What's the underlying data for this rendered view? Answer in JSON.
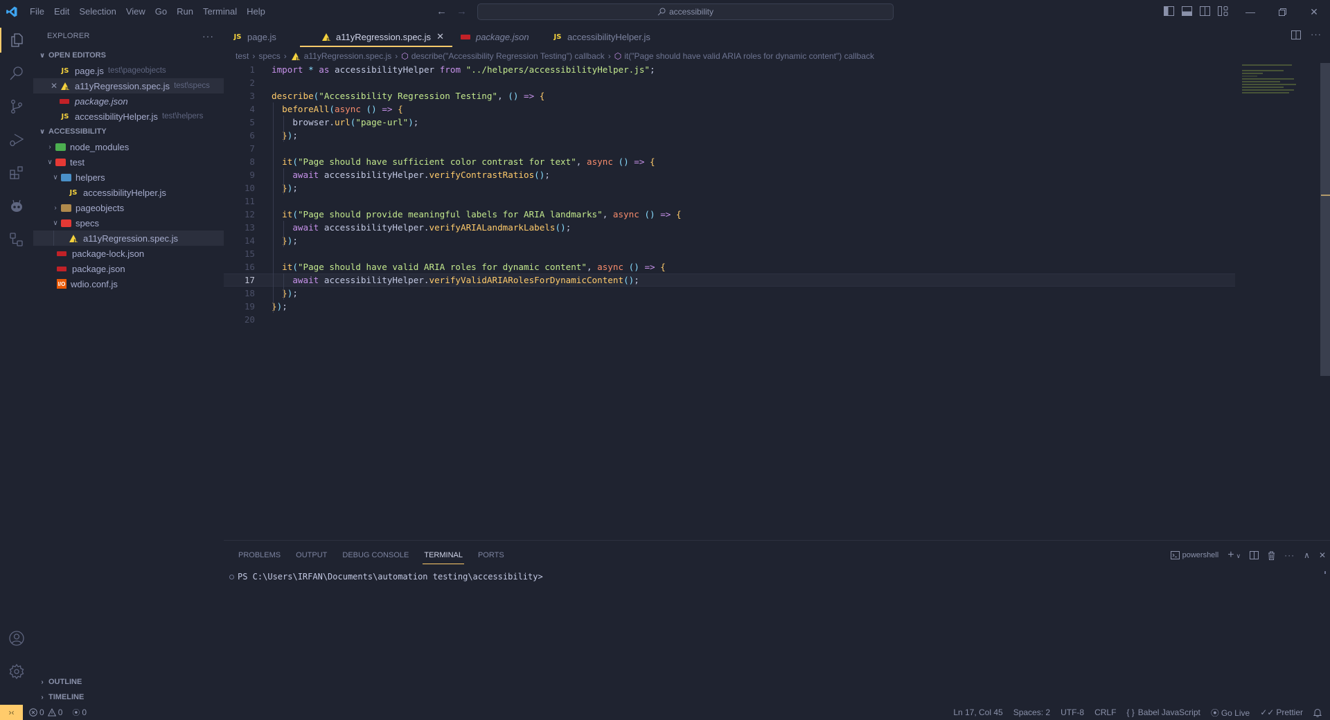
{
  "titlebar": {
    "menu": [
      "File",
      "Edit",
      "Selection",
      "View",
      "Go",
      "Run",
      "Terminal",
      "Help"
    ],
    "command_center": "accessibility",
    "window_controls": [
      "minimize",
      "restore",
      "close"
    ]
  },
  "activity_bar": {
    "items": [
      "explorer",
      "search",
      "source-control",
      "run-and-debug",
      "extensions",
      "platformio",
      "remote-explorer"
    ],
    "bottom": [
      "accounts",
      "manage"
    ]
  },
  "sidebar": {
    "title": "EXPLORER",
    "open_editors_label": "OPEN EDITORS",
    "open_editors": [
      {
        "icon": "js",
        "name": "page.js",
        "desc": "test\\pageobjects",
        "italic": false
      },
      {
        "icon": "spec",
        "name": "a11yRegression.spec.js",
        "desc": "test\\specs",
        "italic": false,
        "selected": true
      },
      {
        "icon": "npm",
        "name": "package.json",
        "desc": "",
        "italic": true
      },
      {
        "icon": "js",
        "name": "accessibilityHelper.js",
        "desc": "test\\helpers",
        "italic": false
      }
    ],
    "project_label": "ACCESSIBILITY",
    "tree": [
      {
        "name": "node_modules",
        "type": "folder",
        "icon": "folder-node",
        "expanded": false,
        "depth": 0
      },
      {
        "name": "test",
        "type": "folder",
        "icon": "folder-test",
        "expanded": true,
        "depth": 0
      },
      {
        "name": "helpers",
        "type": "folder",
        "icon": "folder-helper",
        "expanded": true,
        "depth": 1
      },
      {
        "name": "accessibilityHelper.js",
        "type": "file",
        "icon": "js",
        "depth": 2
      },
      {
        "name": "pageobjects",
        "type": "folder",
        "icon": "folder",
        "expanded": false,
        "depth": 1
      },
      {
        "name": "specs",
        "type": "folder",
        "icon": "folder-test",
        "expanded": true,
        "depth": 1
      },
      {
        "name": "a11yRegression.spec.js",
        "type": "file",
        "icon": "spec",
        "depth": 2,
        "selected": true
      },
      {
        "name": "package-lock.json",
        "type": "file",
        "icon": "npm",
        "depth": 0
      },
      {
        "name": "package.json",
        "type": "file",
        "icon": "npm",
        "depth": 0
      },
      {
        "name": "wdio.conf.js",
        "type": "file",
        "icon": "wdio",
        "depth": 0
      }
    ],
    "outline_label": "OUTLINE",
    "timeline_label": "TIMELINE"
  },
  "tabs": [
    {
      "icon": "js",
      "label": "page.js",
      "active": false,
      "italic": false
    },
    {
      "icon": "spec",
      "label": "a11yRegression.spec.js",
      "active": true,
      "italic": false
    },
    {
      "icon": "npm",
      "label": "package.json",
      "active": false,
      "italic": true
    },
    {
      "icon": "js",
      "label": "accessibilityHelper.js",
      "active": false,
      "italic": false
    }
  ],
  "breadcrumb": [
    "test",
    "specs",
    "a11yRegression.spec.js",
    "describe(\"Accessibility Regression Testing\") callback",
    "it(\"Page should have valid ARIA roles for dynamic content\") callback"
  ],
  "editor": {
    "current_line": 17,
    "lines": [
      "import * as accessibilityHelper from \"../helpers/accessibilityHelper.js\";",
      "",
      "describe(\"Accessibility Regression Testing\", () => {",
      "  beforeAll(async () => {",
      "    browser.url(\"page-url\");",
      "  });",
      "",
      "  it(\"Page should have sufficient color contrast for text\", async () => {",
      "    await accessibilityHelper.verifyContrastRatios();",
      "  });",
      "",
      "  it(\"Page should provide meaningful labels for ARIA landmarks\", async () => {",
      "    await accessibilityHelper.verifyARIALandmarkLabels();",
      "  });",
      "",
      "  it(\"Page should have valid ARIA roles for dynamic content\", async () => {",
      "    await accessibilityHelper.verifyValidARIARolesForDynamicContent();",
      "  });",
      "});",
      ""
    ]
  },
  "panel": {
    "tabs": [
      "PROBLEMS",
      "OUTPUT",
      "DEBUG CONSOLE",
      "TERMINAL",
      "PORTS"
    ],
    "active_tab": "TERMINAL",
    "shell": "powershell",
    "terminal_prompt": "PS C:\\Users\\IRFAN\\Documents\\automation testing\\accessibility>"
  },
  "statusbar": {
    "errors": "0",
    "warnings": "0",
    "ports": "0",
    "position": "Ln 17, Col 45",
    "indent": "Spaces: 2",
    "encoding": "UTF-8",
    "eol": "CRLF",
    "language": "Babel JavaScript",
    "golive": "Go Live",
    "prettier": "Prettier"
  },
  "colors": {
    "accent": "#ffcb6b",
    "background": "#1f2330",
    "string": "#c3e88d",
    "keyword_purple": "#c792ea"
  }
}
